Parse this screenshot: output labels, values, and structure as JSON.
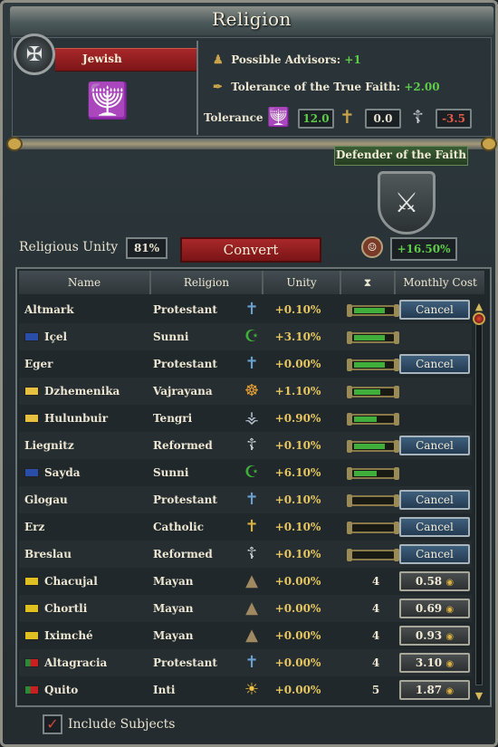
{
  "window": {
    "title": "Religion"
  },
  "faith": {
    "name": "Jewish",
    "icon": "menorah-icon",
    "possible_advisors_label": "Possible Advisors:",
    "possible_advisors_value": "+1",
    "tolerance_true_faith_label": "Tolerance of the True Faith:",
    "tolerance_true_faith_value": "+2.00",
    "tolerance_label": "Tolerance",
    "tolerance_values": [
      "12.0",
      "0.0",
      "-3.5"
    ]
  },
  "defender": {
    "label": "Defender of the Faith"
  },
  "unity": {
    "label": "Religious Unity",
    "value": "81%",
    "convert_label": "Convert",
    "bonus": "+16.50%"
  },
  "table": {
    "headers": [
      "Name",
      "Religion",
      "Unity",
      "",
      "Monthly Cost"
    ],
    "rows": [
      {
        "name": "Altmark",
        "flag": "",
        "religion": "Protestant",
        "icon": "cross-blue-icon",
        "unity": "+0.10%",
        "progress": 0.8,
        "count": "",
        "action": "Cancel"
      },
      {
        "name": "Içel",
        "flag": "blue",
        "religion": "Sunni",
        "icon": "crescent-icon",
        "unity": "+3.10%",
        "progress": 0.8,
        "count": "",
        "action": ""
      },
      {
        "name": "Eger",
        "flag": "",
        "religion": "Protestant",
        "icon": "cross-blue-icon",
        "unity": "+0.00%",
        "progress": 0.8,
        "count": "",
        "action": "Cancel"
      },
      {
        "name": "Dzhemenika",
        "flag": "yellow",
        "religion": "Vajrayana",
        "icon": "dharma-wheel-icon",
        "unity": "+1.10%",
        "progress": 0.7,
        "count": "",
        "action": ""
      },
      {
        "name": "Hulunbuir",
        "flag": "yellow",
        "religion": "Tengri",
        "icon": "tengri-icon",
        "unity": "+0.90%",
        "progress": 0.6,
        "count": "",
        "action": ""
      },
      {
        "name": "Liegnitz",
        "flag": "",
        "religion": "Reformed",
        "icon": "cross-white-icon",
        "unity": "+0.10%",
        "progress": 0.8,
        "count": "",
        "action": "Cancel"
      },
      {
        "name": "Sayda",
        "flag": "blue",
        "religion": "Sunni",
        "icon": "crescent-icon",
        "unity": "+6.10%",
        "progress": 0.6,
        "count": "",
        "action": ""
      },
      {
        "name": "Glogau",
        "flag": "",
        "religion": "Protestant",
        "icon": "cross-blue-icon",
        "unity": "+0.10%",
        "progress": 0.0,
        "count": "",
        "action": "Cancel"
      },
      {
        "name": "Erz",
        "flag": "",
        "religion": "Catholic",
        "icon": "cross-gold-icon",
        "unity": "+0.10%",
        "progress": 0.0,
        "count": "",
        "action": "Cancel"
      },
      {
        "name": "Breslau",
        "flag": "",
        "religion": "Reformed",
        "icon": "cross-white-icon",
        "unity": "+0.10%",
        "progress": 0.0,
        "count": "",
        "action": "Cancel"
      },
      {
        "name": "Chacujal",
        "flag": "mayan",
        "religion": "Mayan",
        "icon": "pyramid-icon",
        "unity": "+0.00%",
        "progress": 0.0,
        "count": "4",
        "action": "0.58"
      },
      {
        "name": "Chortli",
        "flag": "mayan",
        "religion": "Mayan",
        "icon": "pyramid-icon",
        "unity": "+0.00%",
        "progress": 0.0,
        "count": "4",
        "action": "0.69"
      },
      {
        "name": "Iximché",
        "flag": "mayan",
        "religion": "Mayan",
        "icon": "pyramid-icon",
        "unity": "+0.00%",
        "progress": 0.0,
        "count": "4",
        "action": "0.93"
      },
      {
        "name": "Altagracia",
        "flag": "portugal",
        "religion": "Protestant",
        "icon": "cross-blue-icon",
        "unity": "+0.00%",
        "progress": 0.0,
        "count": "4",
        "action": "3.10"
      },
      {
        "name": "Quito",
        "flag": "portugal",
        "religion": "Inti",
        "icon": "sun-icon",
        "unity": "+0.00%",
        "progress": 0.0,
        "count": "5",
        "action": "1.87"
      }
    ]
  },
  "footer": {
    "include_subjects_label": "Include Subjects",
    "include_subjects_checked": true
  }
}
